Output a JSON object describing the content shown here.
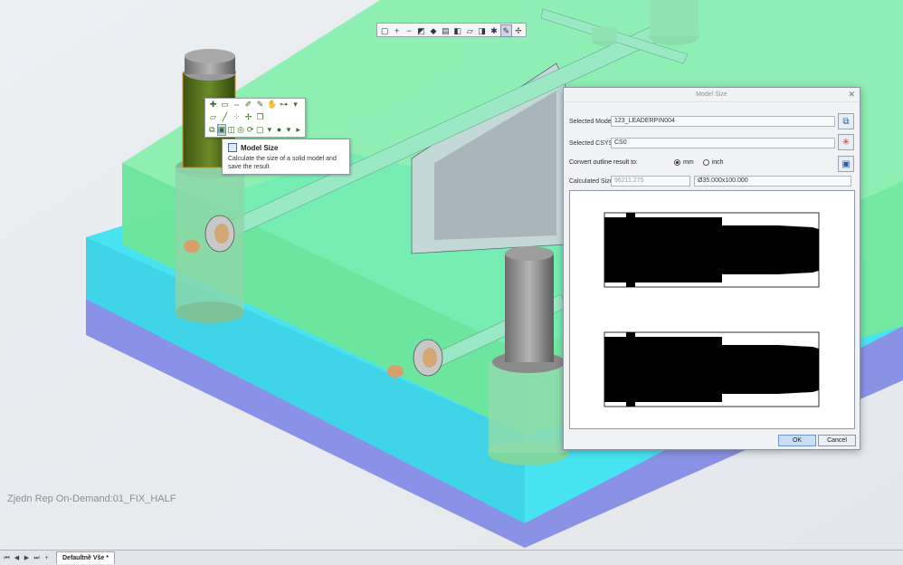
{
  "viewport": {
    "representation_label": "Zjedn Rep On-Demand:01_FIX_HALF"
  },
  "view_toolbar": {
    "buttons": [
      "refit-icon",
      "zoom-in-icon",
      "zoom-out-icon",
      "repaint-icon",
      "orient-icon",
      "saved-views-icon",
      "display-style-icon",
      "perspective-icon",
      "section-icon",
      "datum-display-icon",
      "annotation-icon",
      "spin-center-icon"
    ]
  },
  "tooltip": {
    "title": "Model Size",
    "description": "Calculate the size of a solid model and save the result"
  },
  "dialog": {
    "title": "Model Size",
    "selected_model_label": "Selected Model",
    "selected_model_value": "123_LEADERPIN004",
    "selected_csys_label": "Selected CSYS",
    "selected_csys_value": "CS0",
    "convert_label": "Convert outline result to:",
    "unit_mm": "mm",
    "unit_inch": "inch",
    "unit_selected": "mm",
    "calculated_size_label": "Calculated Size",
    "calculated_size_value": "96211.275",
    "calculated_dims_value": "Ø35.000x100.000",
    "ok_label": "OK",
    "cancel_label": "Cancel"
  },
  "tabbar": {
    "active_tab": "Defaultně Vše *"
  },
  "colors": {
    "mold_green": "#6fe8a0",
    "plate_cyan": "#45e0ef",
    "plate_blue": "#7f8de8",
    "pin_olive": "#4e6a18"
  }
}
